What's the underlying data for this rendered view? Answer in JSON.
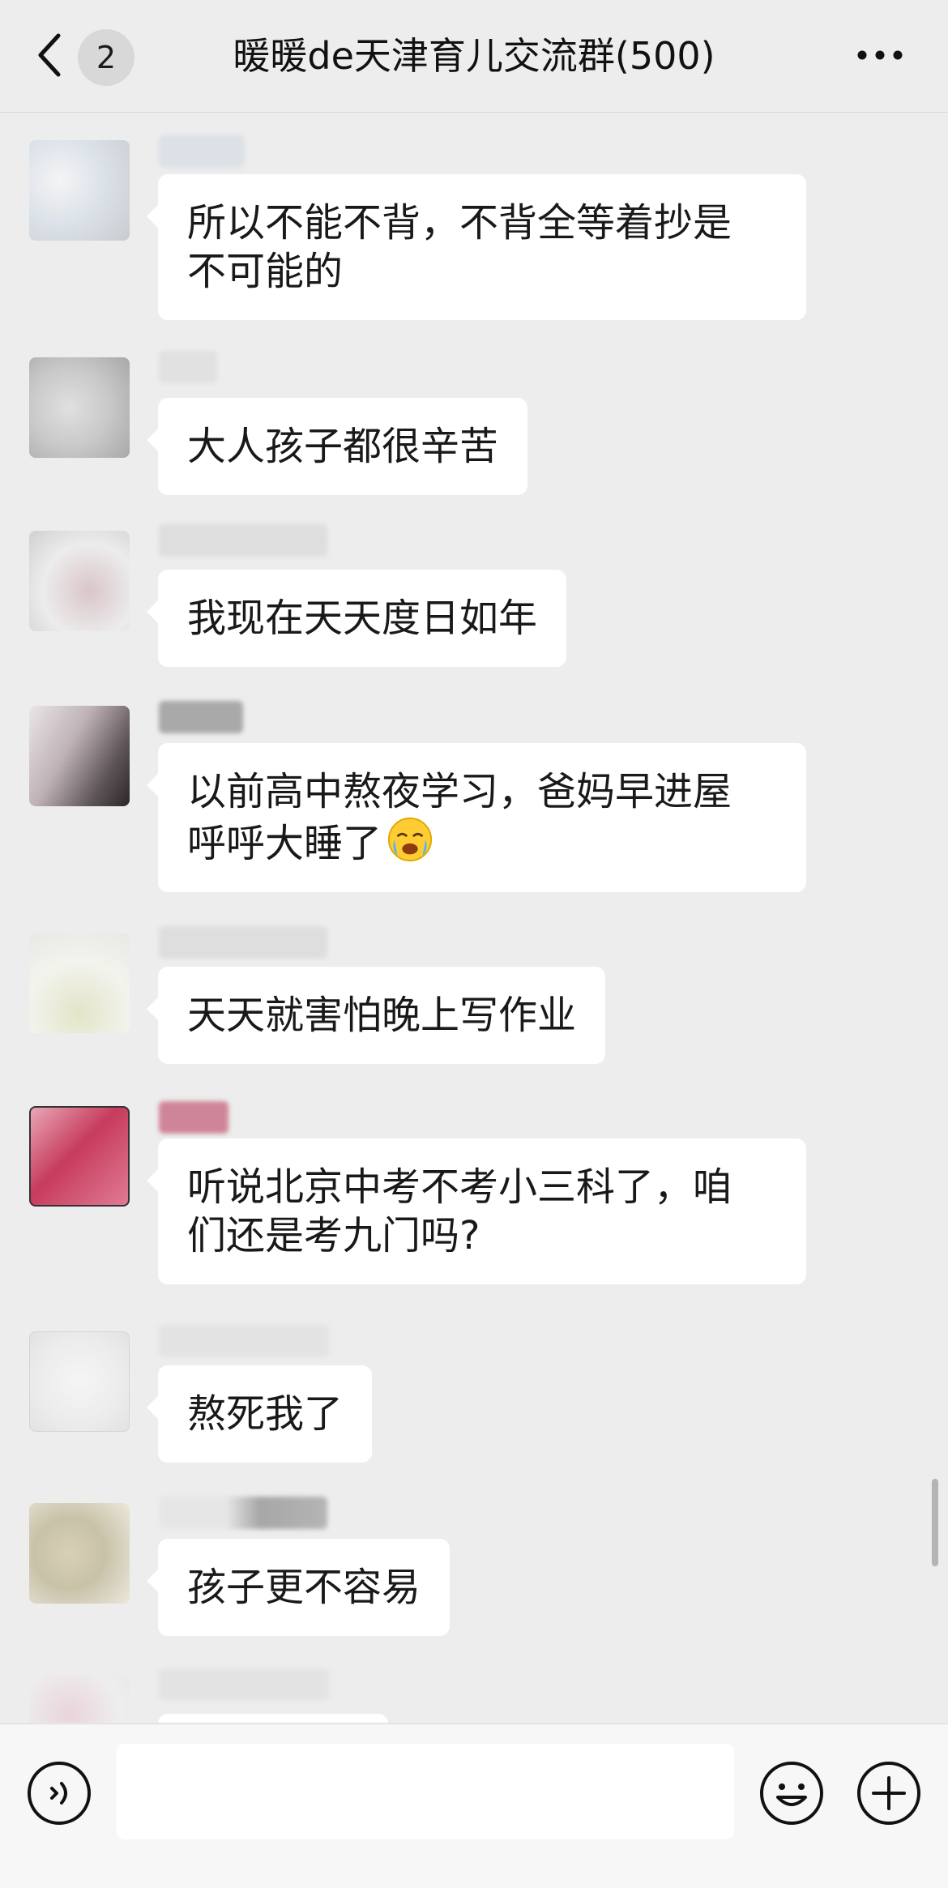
{
  "header": {
    "back_icon": "chevron-left-icon",
    "unread_count": "2",
    "title": "暖暖de天津育儿交流群(500)",
    "more_icon": "more-dots-icon"
  },
  "messages": [
    {
      "text": "所以不能不背，不背全等着抄是\n不可能的"
    },
    {
      "text": "大人孩子都很辛苦"
    },
    {
      "text": "我现在天天度日如年"
    },
    {
      "text": "以前高中熬夜学习，爸妈早进屋\n呼呼大睡了",
      "emoji": "crying-face-emoji"
    },
    {
      "text": "天天就害怕晚上写作业"
    },
    {
      "text": "听说北京中考不考小三科了，咱\n们还是考九门吗?"
    },
    {
      "text": "熬死我了"
    },
    {
      "text": "孩子更不容易"
    }
  ],
  "input_bar": {
    "voice_icon": "voice-icon",
    "input_value": "",
    "emoji_icon": "emoji-icon",
    "plus_icon": "plus-icon"
  },
  "colors": {
    "background": "#ededed",
    "bubble": "#ffffff",
    "text": "#191919",
    "input_bar": "#f7f7f7"
  }
}
